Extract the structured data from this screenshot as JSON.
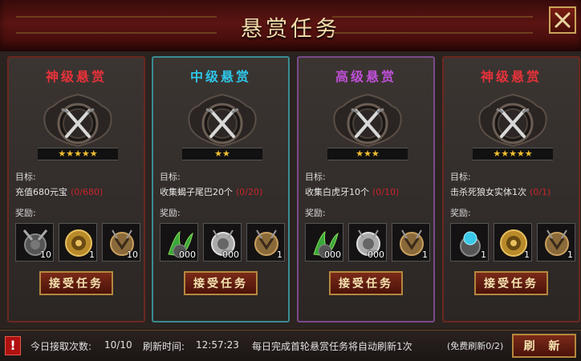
{
  "header": {
    "title": "悬赏任务"
  },
  "labels": {
    "goal": "目标:",
    "reward": "奖励:",
    "accept": "接受任务"
  },
  "cards": [
    {
      "title": "神级悬赏",
      "title_color": "#e8323a",
      "stars": "★★★★★",
      "goal_text": "充值680元宝",
      "goal_count": "(0/680)",
      "rewards": [
        {
          "icon": "shield-lance-icon",
          "qty": "10"
        },
        {
          "icon": "gold-shield-icon",
          "qty": "1"
        },
        {
          "icon": "tiger-shield-icon",
          "qty": "10"
        }
      ]
    },
    {
      "title": "中级悬赏",
      "title_color": "#2ec6e8",
      "stars": "★★",
      "goal_text": "收集蝎子尾巴20个",
      "goal_count": "(0/20)",
      "rewards": [
        {
          "icon": "green-herb-icon",
          "qty": "000"
        },
        {
          "icon": "silver-shield-icon",
          "qty": "000"
        },
        {
          "icon": "tiger-shield-icon",
          "qty": "1"
        }
      ]
    },
    {
      "title": "高级悬赏",
      "title_color": "#c050d8",
      "stars": "★★★",
      "goal_text": "收集白虎牙10个",
      "goal_count": "(0/10)",
      "rewards": [
        {
          "icon": "green-herb-icon",
          "qty": "000"
        },
        {
          "icon": "silver-shield-icon",
          "qty": "000"
        },
        {
          "icon": "tiger-shield-icon",
          "qty": "1"
        }
      ]
    },
    {
      "title": "神级悬赏",
      "title_color": "#e8323a",
      "stars": "★★★★★",
      "goal_text": "击杀死狼女实体1次",
      "goal_count": "(0/1)",
      "rewards": [
        {
          "icon": "blue-orb-shield-icon",
          "qty": "1"
        },
        {
          "icon": "gold-shield-icon",
          "qty": "1"
        },
        {
          "icon": "tiger-shield-icon",
          "qty": "1"
        }
      ]
    }
  ],
  "footer": {
    "daily_label": "今日接取次数:",
    "daily_value": "10/10",
    "refresh_time_label": "刷新时间:",
    "refresh_time_value": "12:57:23",
    "notice": "每日完成首轮悬赏任务将自动刷新1次",
    "free_refresh": "(免费刷新0/2)",
    "refresh_button": "刷 新"
  },
  "colors": {
    "accent": "#b5873d",
    "header": "#5b1411",
    "count_red": "#c8242a",
    "star": "#f0c030"
  }
}
